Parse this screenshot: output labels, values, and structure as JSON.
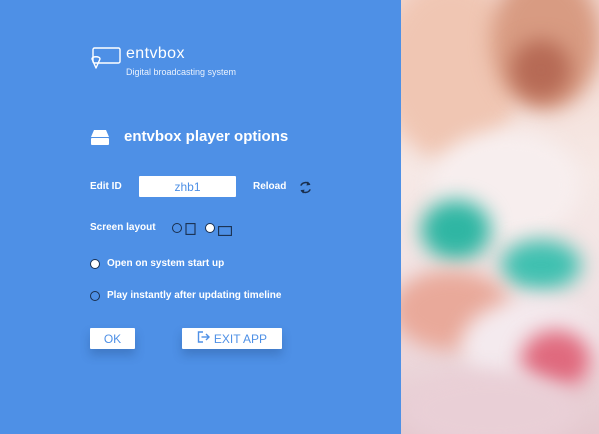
{
  "app": {
    "name": "entvbox",
    "tagline": "Digital broadcasting system"
  },
  "options": {
    "title": "entvbox player options",
    "edit_id_label": "Edit ID",
    "edit_id_value": "zhb1",
    "reload_label": "Reload",
    "screen_layout_label": "Screen layout",
    "screen_layout_options": [
      "portrait",
      "landscape"
    ],
    "screen_layout_selected": "landscape",
    "open_on_startup_label": "Open on system start up",
    "open_on_startup_checked": true,
    "play_instantly_label": "Play instantly after updating timeline",
    "play_instantly_checked": false
  },
  "buttons": {
    "ok_label": "OK",
    "exit_label": "EXIT APP"
  },
  "colors": {
    "panel": "#4e90e6",
    "text": "#ffffff",
    "accent": "#4e90e6"
  }
}
